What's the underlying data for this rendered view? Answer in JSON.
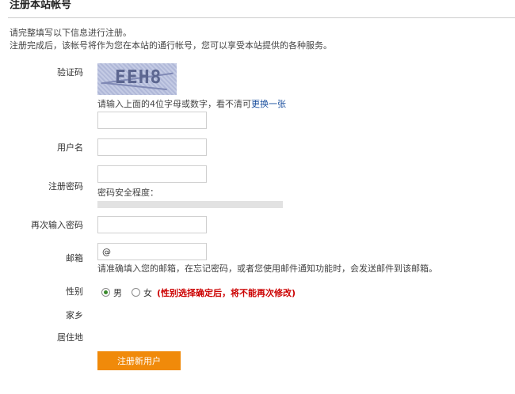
{
  "page": {
    "title": "注册本站帐号",
    "intro_line1": "请完整填写以下信息进行注册。",
    "intro_line2": "注册完成后，该帐号将作为您在本站的通行帐号，您可以享受本站提供的各种服务。"
  },
  "form": {
    "captcha": {
      "label": "验证码",
      "image_text": "EEH8",
      "hint": "请输入上面的4位字母或数字，看不清可",
      "refresh_link": "更换一张",
      "value": ""
    },
    "username": {
      "label": "用户名",
      "value": ""
    },
    "password": {
      "label": "注册密码",
      "value": "",
      "strength_label": "密码安全程度："
    },
    "password_confirm": {
      "label": "再次输入密码",
      "value": ""
    },
    "email": {
      "label": "邮箱",
      "value": "@",
      "hint": "请准确填入您的邮箱，在忘记密码，或者您使用邮件通知功能时，会发送邮件到该邮箱。"
    },
    "gender": {
      "label": "性别",
      "options": [
        "男",
        "女"
      ],
      "selected": "男",
      "note": "(性别选择确定后，将不能再次修改)"
    },
    "hometown": {
      "label": "家乡"
    },
    "residence": {
      "label": "居住地"
    },
    "submit_label": "注册新用户"
  },
  "colors": {
    "accent_button": "#f08a0a",
    "link": "#1a4f9e",
    "warning": "#cc0000",
    "radio_selected": "#3a8a2c"
  }
}
